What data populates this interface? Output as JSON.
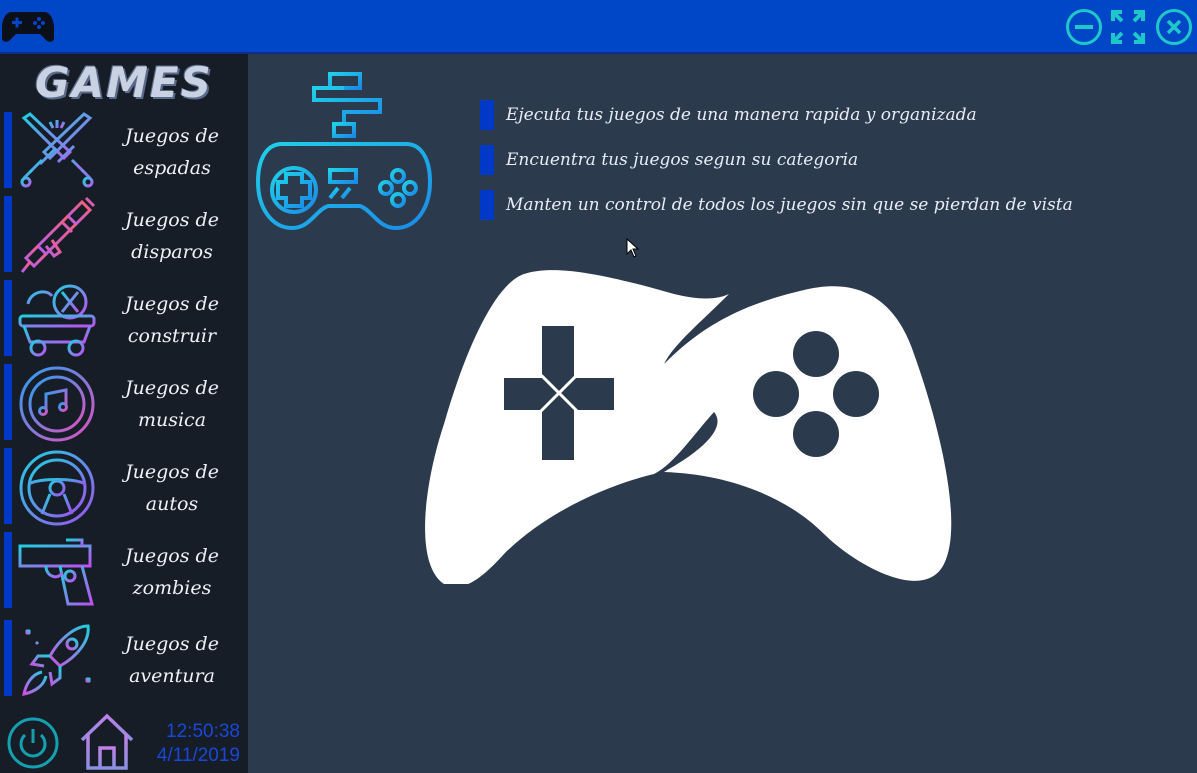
{
  "window": {
    "minimize_icon": "minimize-icon",
    "maximize_icon": "maximize-icon",
    "close_icon": "close-icon",
    "accent_color": "#1ec8c8",
    "titlebar_color": "#0047c8"
  },
  "sidebar": {
    "brand": "GAMES",
    "items": [
      {
        "line1": "Juegos de",
        "line2": "espadas",
        "icon": "crossed-swords-icon"
      },
      {
        "line1": "Juegos de",
        "line2": "disparos",
        "icon": "rifle-icon"
      },
      {
        "line1": "Juegos de",
        "line2": "construir",
        "icon": "wheelbarrow-icon"
      },
      {
        "line1": "Juegos de",
        "line2": "musica",
        "icon": "music-disc-icon"
      },
      {
        "line1": "Juegos de",
        "line2": "autos",
        "icon": "steering-wheel-icon"
      },
      {
        "line1": "Juegos de",
        "line2": "zombies",
        "icon": "pistol-icon"
      },
      {
        "line1": "Juegos de",
        "line2": "aventura",
        "icon": "rocket-icon"
      }
    ],
    "time": "12:50:38",
    "date": "4/11/2019"
  },
  "main": {
    "features": [
      "Ejecuta tus juegos de una manera rapida y organizada",
      "Encuentra tus juegos segun su categoria",
      "Manten un control de todos los juegos sin que se pierdan de vista"
    ]
  }
}
